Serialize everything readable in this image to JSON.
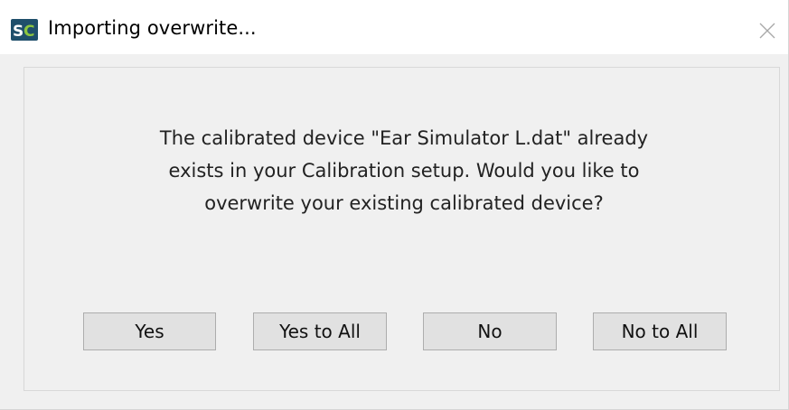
{
  "window": {
    "title": "Importing overwrite...",
    "app_icon_label": "SC"
  },
  "dialog": {
    "message_lines": [
      "The calibrated device \"Ear Simulator L.dat\" already",
      "exists in your Calibration setup. Would you like to",
      "overwrite your existing calibrated device?"
    ],
    "buttons": {
      "yes": "Yes",
      "yes_to_all": "Yes to All",
      "no": "No",
      "no_to_all": "No to All"
    }
  },
  "colors": {
    "dialog_background": "#f0f0f0",
    "button_background": "#e1e1e1",
    "button_border": "#adadad",
    "icon_background": "#1f4f6b",
    "icon_accent": "#8dc63f"
  },
  "icons": {
    "app": "sc-logo-icon",
    "close": "close-icon"
  }
}
